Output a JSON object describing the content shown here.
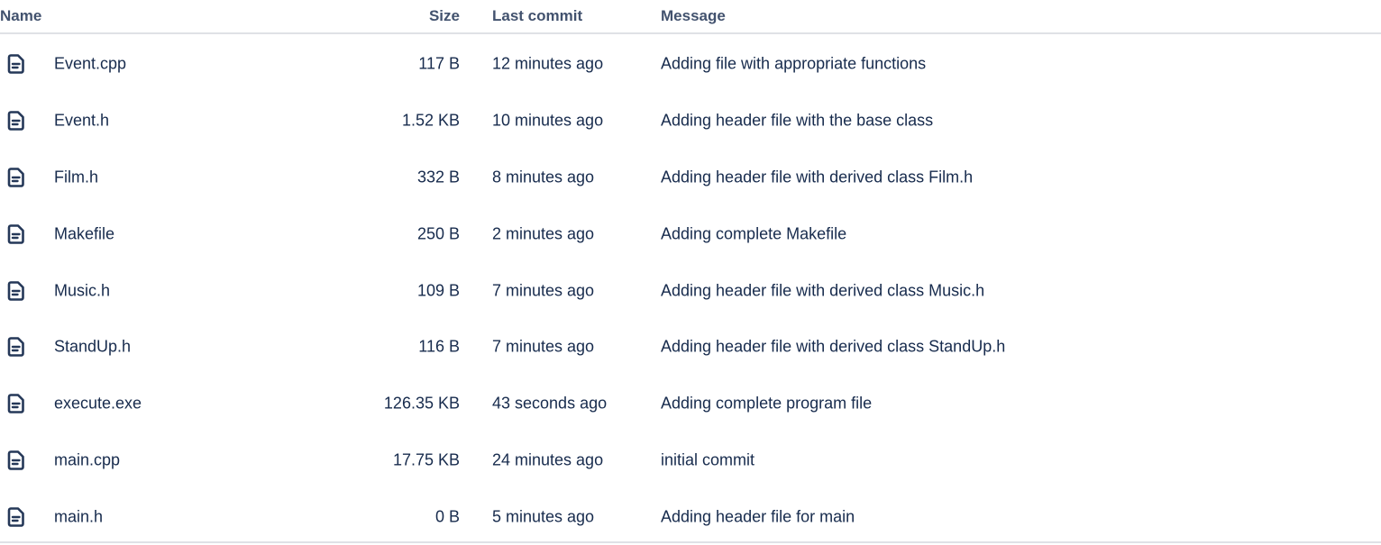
{
  "table": {
    "headers": {
      "name": "Name",
      "size": "Size",
      "last_commit": "Last commit",
      "message": "Message"
    },
    "rows": [
      {
        "icon": "file-icon",
        "name": "Event.cpp",
        "size": "117 B",
        "last_commit": "12 minutes ago",
        "message": "Adding file with appropriate functions"
      },
      {
        "icon": "file-icon",
        "name": "Event.h",
        "size": "1.52 KB",
        "last_commit": "10 minutes ago",
        "message": "Adding header file with the base class"
      },
      {
        "icon": "file-icon",
        "name": "Film.h",
        "size": "332 B",
        "last_commit": "8 minutes ago",
        "message": "Adding header file with derived class Film.h"
      },
      {
        "icon": "file-icon",
        "name": "Makefile",
        "size": "250 B",
        "last_commit": "2 minutes ago",
        "message": "Adding complete Makefile"
      },
      {
        "icon": "file-icon",
        "name": "Music.h",
        "size": "109 B",
        "last_commit": "7 minutes ago",
        "message": "Adding header file with derived class Music.h"
      },
      {
        "icon": "file-icon",
        "name": "StandUp.h",
        "size": "116 B",
        "last_commit": "7 minutes ago",
        "message": "Adding header file with derived class StandUp.h"
      },
      {
        "icon": "file-icon",
        "name": "execute.exe",
        "size": "126.35 KB",
        "last_commit": "43 seconds ago",
        "message": "Adding complete program file"
      },
      {
        "icon": "file-icon",
        "name": "main.cpp",
        "size": "17.75 KB",
        "last_commit": "24 minutes ago",
        "message": "initial commit"
      },
      {
        "icon": "file-icon",
        "name": "main.h",
        "size": "0 B",
        "last_commit": "5 minutes ago",
        "message": "Adding header file for main"
      }
    ]
  },
  "colors": {
    "text": "#172b4d",
    "header_text": "#42526e",
    "divider": "#dfe1e6",
    "icon": "#253858"
  }
}
